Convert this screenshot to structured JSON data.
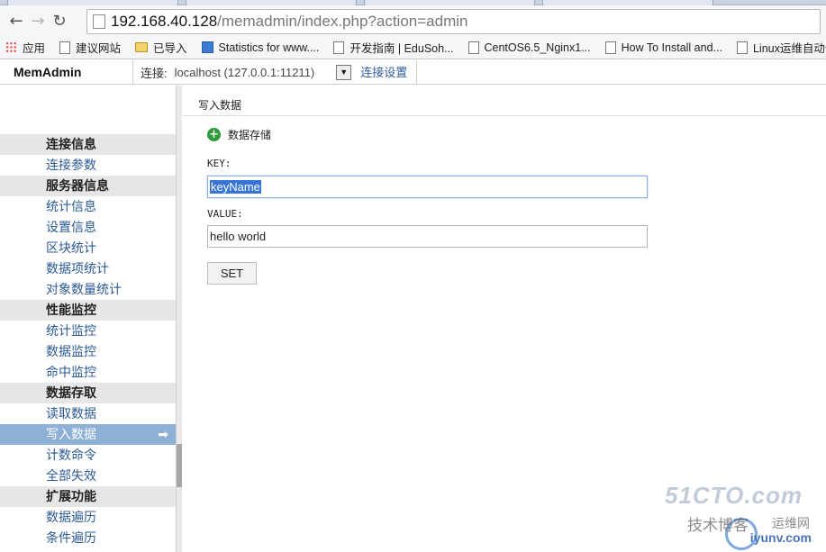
{
  "browser": {
    "url_host": "192.168.40.128",
    "url_path": "/memadmin/index.php?action=admin",
    "bookmarks": [
      {
        "label": "应用",
        "icon": "apps-icon"
      },
      {
        "label": "建议网站",
        "icon": "page-icon"
      },
      {
        "label": "已导入",
        "icon": "folder-icon"
      },
      {
        "label": "Statistics for www....",
        "icon": "stats-icon"
      },
      {
        "label": "开发指南 | EduSoh...",
        "icon": "page-icon"
      },
      {
        "label": "CentOS6.5_Nginx1...",
        "icon": "page-icon"
      },
      {
        "label": "How To Install and...",
        "icon": "page-icon"
      },
      {
        "label": "Linux运维自动化",
        "icon": "page-icon"
      }
    ]
  },
  "header": {
    "brand": "MemAdmin",
    "conn_label": "连接:",
    "conn_value": "localhost (127.0.0.1:11211)",
    "conn_settings": "连接设置"
  },
  "sidebar": {
    "sections": [
      {
        "title": "连接信息",
        "items": [
          "连接参数"
        ]
      },
      {
        "title": "服务器信息",
        "items": [
          "统计信息",
          "设置信息",
          "区块统计",
          "数据项统计",
          "对象数量统计"
        ]
      },
      {
        "title": "性能监控",
        "items": [
          "统计监控",
          "数据监控",
          "命中监控"
        ]
      },
      {
        "title": "数据存取",
        "items": [
          "读取数据",
          "写入数据",
          "计数命令",
          "全部失效"
        ]
      },
      {
        "title": "扩展功能",
        "items": [
          "数据遍历",
          "条件遍历"
        ]
      }
    ],
    "active_item": "写入数据",
    "active_arrow": "➡"
  },
  "main": {
    "title": "写入数据",
    "save_label": "数据存储",
    "key_label": "KEY:",
    "key_value": "keyName",
    "value_label": "VALUE:",
    "value_value": "hello world",
    "set_button": "SET"
  },
  "watermark": {
    "line1": "51CTO.com",
    "line2": "技术博客",
    "line3": "运维网",
    "line4": "iyunv.com"
  },
  "colors": {
    "link": "#2b5a94",
    "active_bg": "#8fb0d6",
    "section_bg": "#e6e6e6",
    "plus_green": "#2e9a3a"
  }
}
